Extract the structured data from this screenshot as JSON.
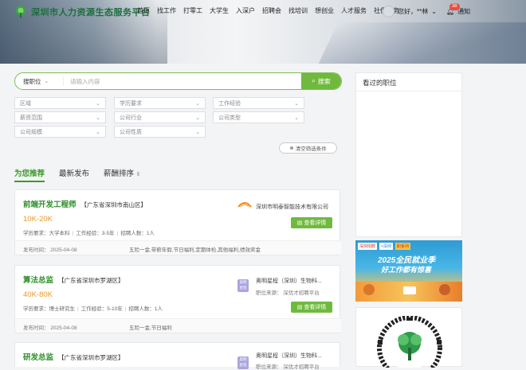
{
  "header": {
    "logo_text": "深圳市人力资源生态服务平台",
    "nav": [
      "首页",
      "找工作",
      "打零工",
      "大学生",
      "入深户",
      "招聘会",
      "找培训",
      "想创业",
      "人才服务",
      "社保服务"
    ],
    "user_greeting": "您好，**林",
    "notif_count": "38",
    "notif_label": "通知"
  },
  "search": {
    "type_label": "搜职位",
    "placeholder": "请输入内容",
    "button_label": "搜索"
  },
  "filters": {
    "row1": [
      "区域",
      "学历要求",
      "工作经验"
    ],
    "row2": [
      "薪资范围",
      "公司行业",
      "公司类型"
    ],
    "row3": [
      "公司规模",
      "公司性质"
    ],
    "clear_label": "清空筛选条件"
  },
  "tabs": {
    "recommend": "为您推荐",
    "latest": "最新发布",
    "salary_sort": "薪酬排序"
  },
  "jobs": [
    {
      "title": "前端开发工程师",
      "location": "【广东省深圳市南山区】",
      "salary": "10K-20K",
      "meta": [
        "学历要求：大学本科",
        "工作经验：3-5年",
        "招聘人数：1人"
      ],
      "company": "深圳市明泰智能技术有限公司",
      "company_sub": "",
      "detail_label": "查看详情",
      "published": "发布时间：  2025-04-08",
      "benefits": "五险一金,带薪年假,节日福利,定期体检,其他福利,绩效奖金"
    },
    {
      "title": "算法总监",
      "location": "【广东省深圳市罗湖区】",
      "salary": "40K-80K",
      "meta": [
        "学历要求：博士研究生",
        "工作经验：5-10年",
        "招聘人数：1人"
      ],
      "company": "奥明星程（深圳）生物科...",
      "company_sub": "职位来源：  深优才招聘平台",
      "detail_label": "查看详情",
      "published": "发布时间：  2025-04-08",
      "benefits": "五险一金,节日福利",
      "logo_text": "奥明 星程"
    },
    {
      "title": "研发总监",
      "location": "【广东省深圳市罗湖区】",
      "salary": "",
      "meta": [],
      "company": "奥明星程（深圳）生物科...",
      "company_sub": "职位来源：  深优才招聘平台",
      "detail_label": "",
      "published": "",
      "benefits": "",
      "logo_text": "奥明 星程"
    }
  ],
  "sidebar": {
    "viewed_title": "看过的职位",
    "ad_headline": "2025全民就业季",
    "ad_subline": "好工作都有惊喜",
    "ad_tags": [
      "深圳招聘",
      "+深圳",
      "职系列"
    ]
  },
  "colors": {
    "primary_green": "#6fba3e",
    "title_green": "#2f8f2a",
    "salary_orange": "#e99a2c",
    "badge_red": "#e94e3c"
  }
}
